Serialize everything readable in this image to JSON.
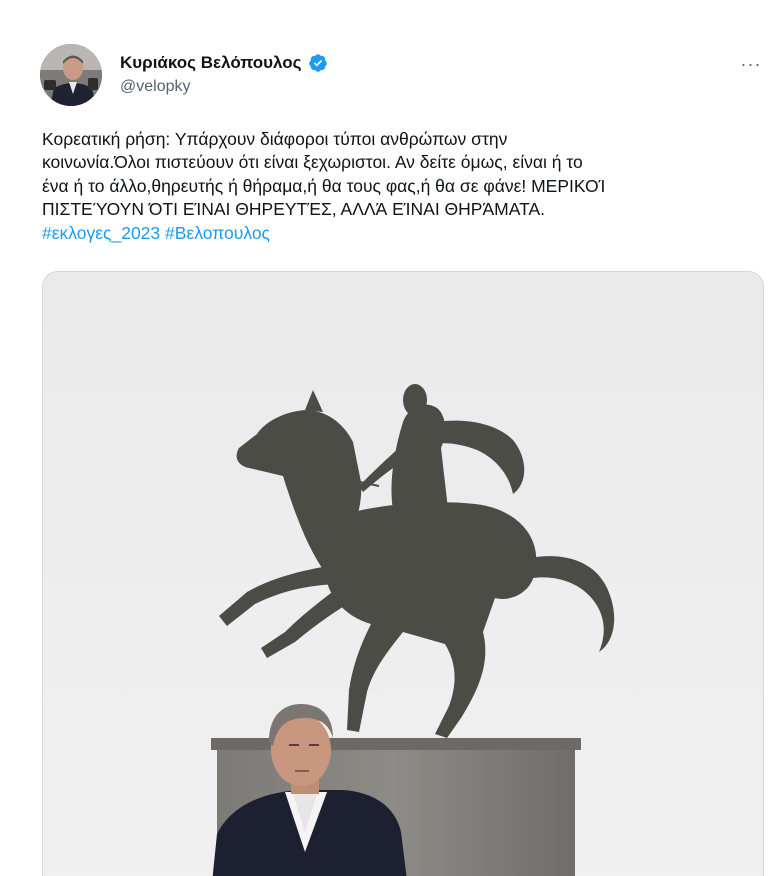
{
  "tweet": {
    "author": {
      "display_name": "Κυριάκος Βελόπουλος",
      "handle": "@velopky",
      "verified": true,
      "avatar_icon": "profile-photo",
      "verified_icon": "verified-badge-icon"
    },
    "more_icon": "more-options-icon",
    "more_label": "···",
    "text_lines": [
      "Κορεατική ρήση: Υπάρχουν διάφοροι τύποι ανθρώπων στην",
      "κοινωνία.Όλοι πιστεύουν ότι είναι ξεχωριστοι. Αν δείτε όμως, είναι ή το",
      "ένα ή το άλλο,θηρευτής ή θήραμα,ή θα τους φας,ή θα σε φάνε! ΜΕΡΙΚΟΊ",
      "ΠΙΣΤΕΎΟΥΝ ΌΤΙ ΕΊΝΑΙ ΘΗΡΕΥΤΈΣ, ΑΛΛΆ ΕΊΝΑΙ ΘΗΡΆΜΑΤΑ."
    ],
    "hashtags": [
      "#εκλογες_2023",
      "#Βελοπουλος"
    ],
    "media": {
      "type": "photo",
      "description_icon": "photo-statue-and-man"
    }
  },
  "colors": {
    "text": "#0f1419",
    "secondary": "#536471",
    "link": "#1d9bf0",
    "verified": "#1d9bf0",
    "border": "#cfd9de"
  }
}
